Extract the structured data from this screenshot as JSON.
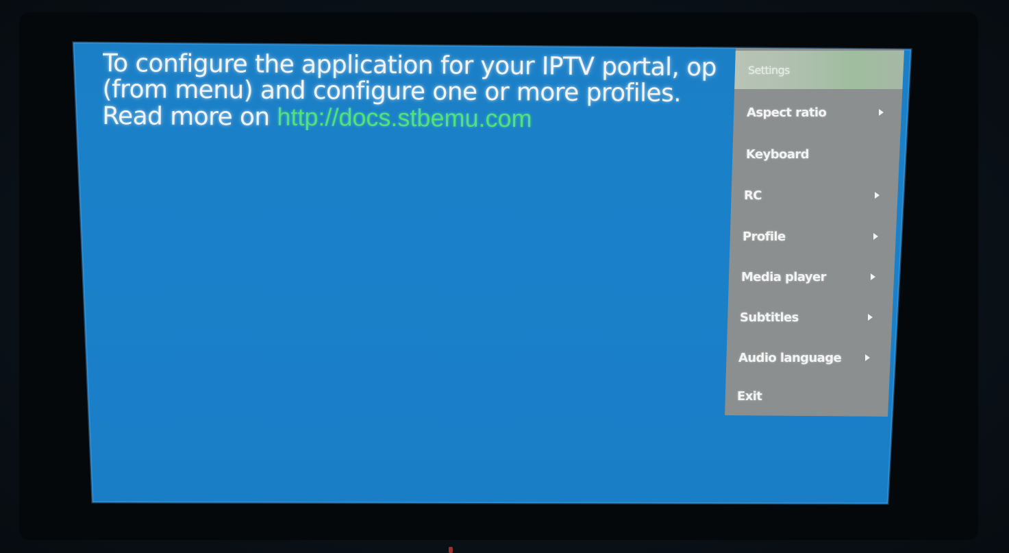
{
  "message": {
    "line1": "To configure the application for your IPTV portal, op",
    "line2": "(from menu) and configure one or more profiles.",
    "read_more_prefix": "Read more on ",
    "docs_link": "http://docs.stbemu.com"
  },
  "menu": {
    "items": [
      {
        "label": "Settings",
        "submenu": false,
        "selected": true
      },
      {
        "label": "Aspect ratio",
        "submenu": true,
        "selected": false
      },
      {
        "label": "Keyboard",
        "submenu": false,
        "selected": false
      },
      {
        "label": "RC",
        "submenu": true,
        "selected": false
      },
      {
        "label": "Profile",
        "submenu": true,
        "selected": false
      },
      {
        "label": "Media player",
        "submenu": true,
        "selected": false
      },
      {
        "label": "Subtitles",
        "submenu": true,
        "selected": false
      },
      {
        "label": "Audio language",
        "submenu": true,
        "selected": false
      },
      {
        "label": "Exit",
        "submenu": false,
        "selected": false
      }
    ]
  },
  "colors": {
    "screen_blue": "#1a80c9",
    "link_green": "#4fe37a",
    "menu_gray": "#8c8f8f",
    "selected_highlight": "#a6b7a6"
  }
}
